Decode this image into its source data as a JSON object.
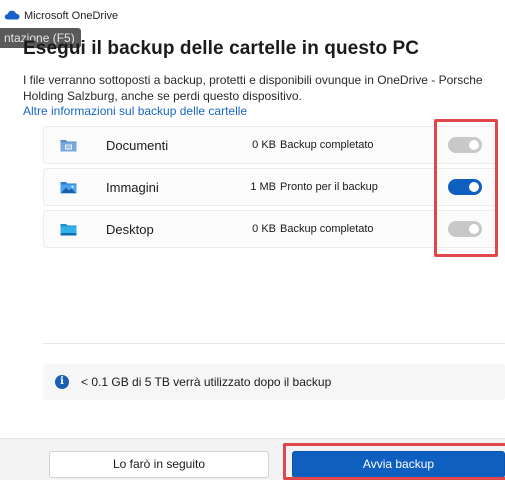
{
  "window": {
    "title": "Microsoft OneDrive",
    "tooltip": "ntazione (F5)"
  },
  "heading": "Esegui il backup delle cartelle in questo PC",
  "description": "I file verranno sottoposti a backup, protetti e disponibili ovunque in OneDrive - Porsche Holding Salzburg, anche se perdi questo dispositivo.",
  "more_info_link": "Altre informazioni sul backup delle cartelle",
  "folders": [
    {
      "name": "Documenti",
      "size": "0 KB",
      "status": "Backup completato",
      "enabled": false,
      "icon": "documents-folder-icon"
    },
    {
      "name": "Immagini",
      "size": "1 MB",
      "status": "Pronto per il backup",
      "enabled": true,
      "icon": "pictures-folder-icon"
    },
    {
      "name": "Desktop",
      "size": "0 KB",
      "status": "Backup completato",
      "enabled": false,
      "icon": "desktop-folder-icon"
    }
  ],
  "storage_info": "< 0.1 GB di 5 TB verrà utilizzato dopo il backup",
  "buttons": {
    "later": "Lo farò in seguito",
    "start_backup": "Avvia backup"
  },
  "colors": {
    "accent": "#0f5fc0",
    "highlight": "#e0474c",
    "link": "#1a66c2"
  }
}
